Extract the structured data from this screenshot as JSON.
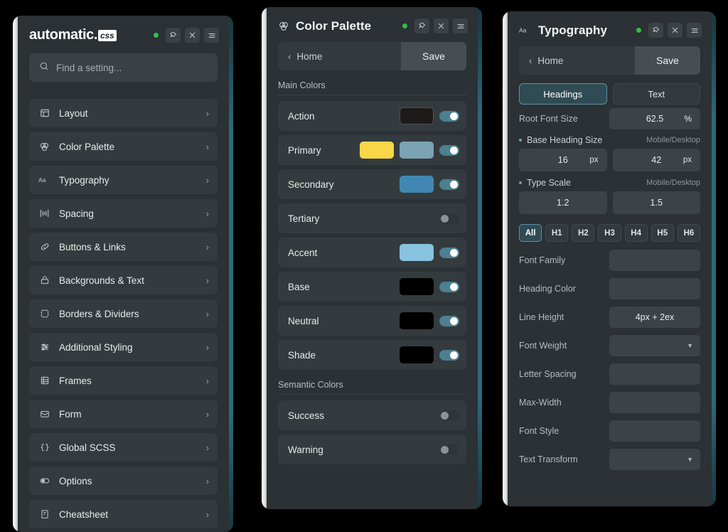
{
  "panel_left": {
    "logo": {
      "word": "automatic",
      "dot": ".",
      "badge": "css"
    },
    "header_icons": [
      "status-dot",
      "pin-icon",
      "close-icon",
      "menu-icon"
    ],
    "search": {
      "placeholder": "Find a setting...",
      "value": "",
      "icon": "search-icon"
    },
    "menu": [
      {
        "label": "Layout",
        "icon": "layout-icon"
      },
      {
        "label": "Color Palette",
        "icon": "color-palette-icon"
      },
      {
        "label": "Typography",
        "icon": "typography-icon"
      },
      {
        "label": "Spacing",
        "icon": "spacing-icon"
      },
      {
        "label": "Buttons & Links",
        "icon": "link-icon"
      },
      {
        "label": "Backgrounds & Text",
        "icon": "background-icon"
      },
      {
        "label": "Borders & Dividers",
        "icon": "border-icon"
      },
      {
        "label": "Additional Styling",
        "icon": "sliders-icon"
      },
      {
        "label": "Frames",
        "icon": "frames-icon"
      },
      {
        "label": "Form",
        "icon": "form-icon"
      },
      {
        "label": "Global SCSS",
        "icon": "braces-icon"
      },
      {
        "label": "Options",
        "icon": "options-icon"
      },
      {
        "label": "Cheatsheet",
        "icon": "cheatsheet-icon"
      }
    ]
  },
  "panel_mid": {
    "title": "Color Palette",
    "title_icon": "color-palette-icon",
    "nav": {
      "back_label": "Home",
      "save_label": "Save"
    },
    "sections": [
      {
        "label": "Main Colors",
        "rows": [
          {
            "label": "Action",
            "swatches": [
              "#1d1a1a"
            ],
            "outline": true,
            "toggle": "on"
          },
          {
            "label": "Primary",
            "swatches": [
              "#f7d747",
              "#7ba3b4"
            ],
            "outline": false,
            "toggle": "on"
          },
          {
            "label": "Secondary",
            "swatches": [
              "#4088b3"
            ],
            "outline": false,
            "toggle": "on"
          },
          {
            "label": "Tertiary",
            "swatches": [],
            "outline": false,
            "toggle": "off"
          },
          {
            "label": "Accent",
            "swatches": [
              "#87c2de"
            ],
            "outline": false,
            "toggle": "on"
          },
          {
            "label": "Base",
            "swatches": [
              "#000000"
            ],
            "outline": false,
            "toggle": "on"
          },
          {
            "label": "Neutral",
            "swatches": [
              "#000000"
            ],
            "outline": false,
            "toggle": "on"
          },
          {
            "label": "Shade",
            "swatches": [
              "#000000"
            ],
            "outline": false,
            "toggle": "on"
          }
        ]
      },
      {
        "label": "Semantic Colors",
        "rows": [
          {
            "label": "Success",
            "swatches": [],
            "outline": false,
            "toggle": "off"
          },
          {
            "label": "Warning",
            "swatches": [],
            "outline": false,
            "toggle": "off"
          }
        ]
      }
    ]
  },
  "panel_right": {
    "title": "Typography",
    "title_icon": "typography-icon",
    "nav": {
      "back_label": "Home",
      "save_label": "Save"
    },
    "tabs": [
      {
        "label": "Headings",
        "active": true
      },
      {
        "label": "Text",
        "active": false
      }
    ],
    "root_font_size": {
      "label": "Root Font Size",
      "value": "62.5",
      "unit": "%"
    },
    "base_heading_size": {
      "label": "Base Heading Size",
      "right_note": "Mobile/Desktop",
      "mobile": {
        "value": "16",
        "unit": "px"
      },
      "desktop": {
        "value": "42",
        "unit": "px"
      }
    },
    "type_scale": {
      "label": "Type Scale",
      "right_note": "Mobile/Desktop",
      "mobile": {
        "value": "1.2",
        "unit": ""
      },
      "desktop": {
        "value": "1.5",
        "unit": ""
      }
    },
    "heading_tabs": [
      {
        "label": "All",
        "active": true
      },
      {
        "label": "H1",
        "active": false
      },
      {
        "label": "H2",
        "active": false
      },
      {
        "label": "H3",
        "active": false
      },
      {
        "label": "H4",
        "active": false
      },
      {
        "label": "H5",
        "active": false
      },
      {
        "label": "H6",
        "active": false
      }
    ],
    "fields": [
      {
        "label": "Font Family",
        "value": "",
        "control": "input"
      },
      {
        "label": "Heading Color",
        "value": "",
        "control": "input"
      },
      {
        "label": "Line Height",
        "value": "4px + 2ex",
        "control": "input"
      },
      {
        "label": "Font Weight",
        "value": "",
        "control": "select"
      },
      {
        "label": "Letter Spacing",
        "value": "",
        "control": "input"
      },
      {
        "label": "Max-Width",
        "value": "",
        "control": "input"
      },
      {
        "label": "Font Style",
        "value": "",
        "control": "input"
      },
      {
        "label": "Text Transform",
        "value": "",
        "control": "select"
      }
    ]
  },
  "theme": {
    "panel_bg": "#2b3134",
    "row_bg": "#343b3e",
    "accent_teal": "#5d93a4",
    "status_green": "#2fbe4c"
  }
}
